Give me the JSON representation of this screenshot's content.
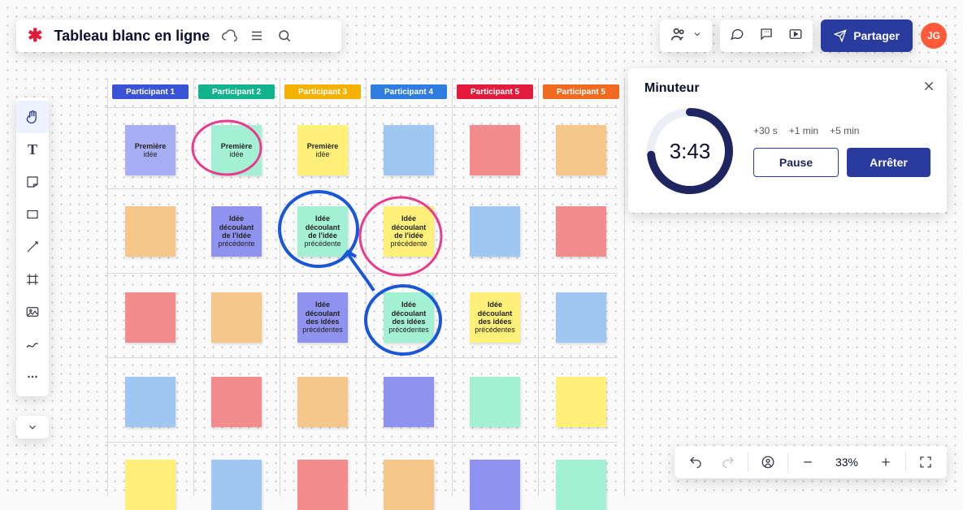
{
  "header": {
    "title": "Tableau blanc en ligne",
    "share_label": "Partager",
    "user_initials": "JG"
  },
  "toolbar": {
    "items": [
      {
        "name": "hand-tool",
        "selected": true
      },
      {
        "name": "text-tool"
      },
      {
        "name": "sticky-tool"
      },
      {
        "name": "shape-tool"
      },
      {
        "name": "line-tool"
      },
      {
        "name": "frame-tool"
      },
      {
        "name": "image-tool"
      },
      {
        "name": "pen-tool"
      },
      {
        "name": "more-tool"
      }
    ]
  },
  "participants": [
    {
      "label": "Participant 1",
      "color": "#3a52d6"
    },
    {
      "label": "Participant 2",
      "color": "#12b28c"
    },
    {
      "label": "Participant 3",
      "color": "#f5b100"
    },
    {
      "label": "Participant 4",
      "color": "#2f7de1"
    },
    {
      "label": "Participant 5",
      "color": "#e21b3c"
    },
    {
      "label": "Participant 5",
      "color": "#f06a1f"
    }
  ],
  "notes_text": {
    "first_idea": "Première idée",
    "idea_prev": "Idée découlant de l'idée précédente",
    "idea_prevs": "Idée découlant des idées précédentes"
  },
  "colors": {
    "c0": "#a8aef3",
    "c1": "#a4f0d4",
    "c2": "#fff07a",
    "c3": "#9fc7f2",
    "c4": "#f38d8d",
    "c5": "#f6c78b",
    "c0b": "#8f92ee"
  },
  "timer": {
    "title": "Minuteur",
    "remaining": "3:43",
    "add": [
      "+30 s",
      "+1 min",
      "+5 min"
    ],
    "pause": "Pause",
    "stop": "Arrêter"
  },
  "zoom": {
    "percent": "33%"
  }
}
